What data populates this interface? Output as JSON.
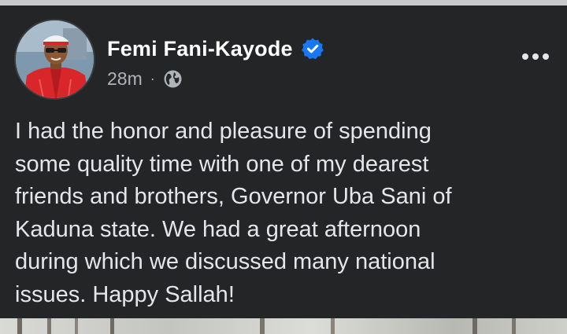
{
  "post": {
    "author_name": "Femi Fani-Kayode",
    "timestamp": "28m",
    "separator": "·",
    "audience_icon": "globe-icon",
    "verified_icon": "verified-badge-icon",
    "more_icon": "more-options-icon",
    "text": "I had the honor and pleasure of spending\nsome quality time with one of my dearest\nfriends and brothers, Governor Uba Sani of\nKaduna state. We had a great afternoon\nduring which we discussed many national\nissues. Happy Sallah!"
  },
  "colors": {
    "background": "#242526",
    "primary_text": "#e4e6eb",
    "secondary_text": "#b0b3b8",
    "verified_blue": "#1877f2"
  }
}
